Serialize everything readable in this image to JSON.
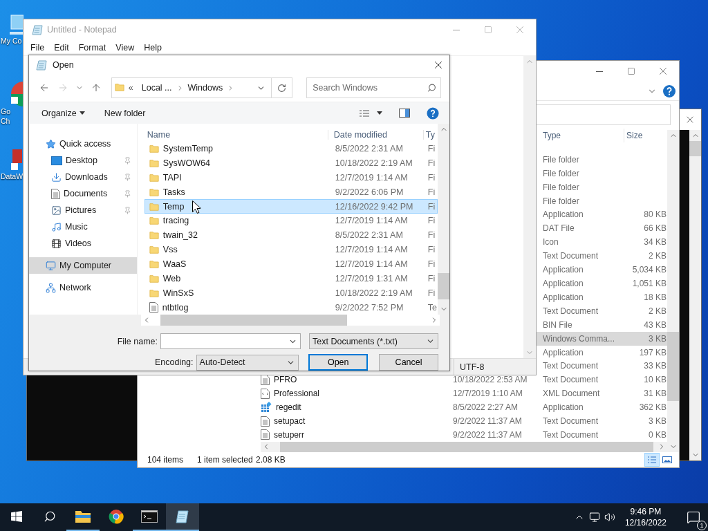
{
  "desktop_icons": [
    {
      "kind": "computer",
      "lines": [
        "My Co"
      ]
    },
    {
      "kind": "chrome",
      "lines": [
        "Go",
        "Ch"
      ]
    },
    {
      "kind": "data",
      "lines": [
        "DataW"
      ]
    }
  ],
  "explorer": {
    "columns": [
      "Type",
      "Size"
    ],
    "rows": [
      {
        "type": "File folder",
        "selected": false
      },
      {
        "type": "File folder",
        "selected": false
      },
      {
        "type": "File folder",
        "selected": false
      },
      {
        "type": "File folder",
        "selected": false
      },
      {
        "type": "Application",
        "size": "80 KB",
        "selected": false
      },
      {
        "type": "DAT File",
        "size": "66 KB",
        "selected": false
      },
      {
        "type": "Icon",
        "size": "34 KB",
        "selected": false
      },
      {
        "type": "Text Document",
        "size": "2 KB",
        "selected": false
      },
      {
        "type": "Application",
        "size": "5,034 KB",
        "selected": false
      },
      {
        "type": "Application",
        "size": "1,051 KB",
        "selected": false
      },
      {
        "type": "Application",
        "size": "18 KB",
        "selected": false
      },
      {
        "type": "Text Document",
        "size": "2 KB",
        "selected": false
      },
      {
        "type": "BIN File",
        "size": "43 KB",
        "selected": false
      },
      {
        "type": "Windows Comma...",
        "size": "3 KB",
        "selected": true
      },
      {
        "type": "Application",
        "size": "197 KB",
        "selected": false
      },
      {
        "type": "Text Document",
        "size": "33 KB",
        "selected": false
      },
      {
        "kind": "text",
        "name": "PFRO",
        "date": "10/18/2022 2:53 AM",
        "type": "Text Document",
        "size": "10 KB",
        "selected": false
      },
      {
        "kind": "xml",
        "name": "Professional",
        "date": "12/7/2019 1:10 AM",
        "type": "XML Document",
        "size": "31 KB",
        "selected": false
      },
      {
        "kind": "app",
        "name": "regedit",
        "date": "8/5/2022 2:27 AM",
        "type": "Application",
        "size": "362 KB",
        "selected": false
      },
      {
        "kind": "text",
        "name": "setupact",
        "date": "9/2/2022 11:37 AM",
        "type": "Text Document",
        "size": "3 KB",
        "selected": false
      },
      {
        "kind": "text",
        "name": "setuperr",
        "date": "9/2/2022 11:37 AM",
        "type": "Text Document",
        "size": "0 KB",
        "selected": false
      }
    ],
    "status": {
      "count": "104 items",
      "selection": "1 item selected",
      "size": "2.08 KB"
    }
  },
  "notepad": {
    "title": "Untitled - Notepad",
    "menu": [
      "File",
      "Edit",
      "Format",
      "View",
      "Help"
    ],
    "status": {
      "encoding": "UTF-8"
    }
  },
  "dialog": {
    "title": "Open",
    "address": {
      "overflow": "«",
      "crumbs": [
        "Local ...",
        "Windows"
      ]
    },
    "search": {
      "placeholder": "Search Windows"
    },
    "toolbar": {
      "organize": "Organize",
      "new_folder": "New folder"
    },
    "nav": [
      {
        "label": "Quick access",
        "kind": "star",
        "selected": false,
        "children": [
          {
            "label": "Desktop",
            "kind": "desktop",
            "pinned": true,
            "selected": false
          },
          {
            "label": "Downloads",
            "kind": "download",
            "pinned": true,
            "selected": false
          },
          {
            "label": "Documents",
            "kind": "documents",
            "pinned": true,
            "selected": false
          },
          {
            "label": "Pictures",
            "kind": "pictures",
            "pinned": true,
            "selected": false
          },
          {
            "label": "Music",
            "kind": "music",
            "pinned": false,
            "selected": false
          },
          {
            "label": "Videos",
            "kind": "videos",
            "pinned": false,
            "selected": false
          }
        ]
      },
      {
        "label": "My Computer",
        "kind": "computer",
        "selected": true
      },
      {
        "label": "Network",
        "kind": "network",
        "selected": false
      }
    ],
    "columns": [
      "Name",
      "Date modified",
      "Ty"
    ],
    "rows": [
      {
        "kind": "folder",
        "name": "SystemTemp",
        "date": "8/5/2022 2:31 AM",
        "type": "Fi",
        "selected": false
      },
      {
        "kind": "folder",
        "name": "SysWOW64",
        "date": "10/18/2022 2:19 AM",
        "type": "Fi",
        "selected": false
      },
      {
        "kind": "folder",
        "name": "TAPI",
        "date": "12/7/2019 1:14 AM",
        "type": "Fi",
        "selected": false
      },
      {
        "kind": "folder",
        "name": "Tasks",
        "date": "9/2/2022 6:06 PM",
        "type": "Fi",
        "selected": false
      },
      {
        "kind": "folder",
        "name": "Temp",
        "date": "12/16/2022 9:42 PM",
        "type": "Fi",
        "selected": true
      },
      {
        "kind": "folder",
        "name": "tracing",
        "date": "12/7/2019 1:14 AM",
        "type": "Fi",
        "selected": false
      },
      {
        "kind": "folder",
        "name": "twain_32",
        "date": "8/5/2022 2:31 AM",
        "type": "Fi",
        "selected": false
      },
      {
        "kind": "folder",
        "name": "Vss",
        "date": "12/7/2019 1:14 AM",
        "type": "Fi",
        "selected": false
      },
      {
        "kind": "folder",
        "name": "WaaS",
        "date": "12/7/2019 1:14 AM",
        "type": "Fi",
        "selected": false
      },
      {
        "kind": "folder",
        "name": "Web",
        "date": "12/7/2019 1:31 AM",
        "type": "Fi",
        "selected": false
      },
      {
        "kind": "folder",
        "name": "WinSxS",
        "date": "10/18/2022 2:19 AM",
        "type": "Fi",
        "selected": false
      },
      {
        "kind": "text",
        "name": "ntbtlog",
        "date": "9/2/2022 7:52 PM",
        "type": "Te",
        "selected": false
      }
    ],
    "file_name": {
      "label": "File name:"
    },
    "file_type": "Text Documents (*.txt)",
    "encoding": {
      "label": "Encoding:",
      "value": "Auto-Detect"
    },
    "buttons": [
      {
        "label": "Open",
        "kind": "primary"
      },
      {
        "label": "Cancel",
        "kind": "normal"
      }
    ]
  },
  "taskbar": {
    "apps": [
      {
        "kind": "explorer",
        "running": true,
        "active": false
      },
      {
        "kind": "chrome",
        "running": false,
        "active": false
      },
      {
        "kind": "console",
        "running": true,
        "active": false
      },
      {
        "kind": "notepad",
        "running": true,
        "active": true
      }
    ],
    "clock": {
      "time": "9:46 PM",
      "date": "12/16/2022"
    },
    "notifications": "1"
  }
}
